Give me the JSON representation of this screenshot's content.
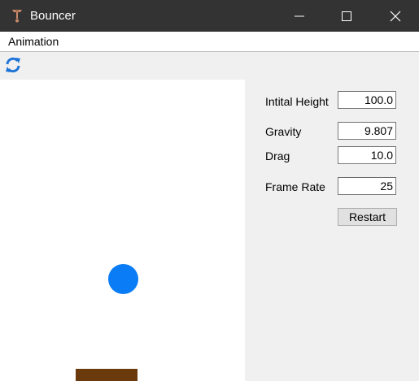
{
  "window": {
    "title": "Bouncer",
    "app_icon": "bouncer-app-icon",
    "controls": [
      "minimize-icon",
      "maximize-icon",
      "close-icon"
    ]
  },
  "menu": {
    "items": [
      {
        "label": "Animation"
      }
    ]
  },
  "toolbar": {
    "refresh_icon": "refresh-icon",
    "accent": "#1e73d8"
  },
  "scene": {
    "ball_color": "#0a7cf5",
    "ground_color": "#6b3a0c",
    "background": "#ffffff"
  },
  "settings": {
    "initial_height": {
      "label": "Intital Height",
      "value": "100.0"
    },
    "gravity": {
      "label": "Gravity",
      "value": "9.807"
    },
    "drag": {
      "label": "Drag",
      "value": "10.0"
    },
    "frame_rate": {
      "label": "Frame Rate",
      "value": "25"
    },
    "restart_label": "Restart"
  }
}
